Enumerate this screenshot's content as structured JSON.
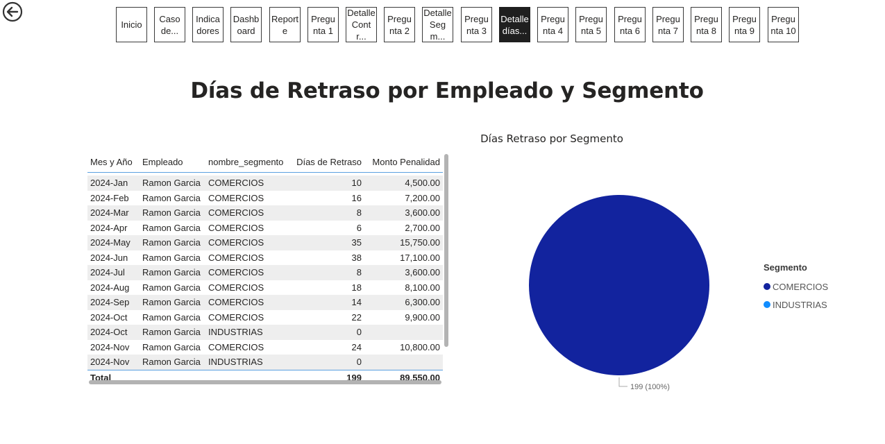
{
  "nav": {
    "back_icon": "back-arrow-icon",
    "buttons": [
      {
        "label": "Inicio",
        "active": false
      },
      {
        "label": "Caso de...",
        "active": false
      },
      {
        "label": "Indicadores",
        "active": false
      },
      {
        "label": "Dashboard",
        "active": false
      },
      {
        "label": "Reporte",
        "active": false
      },
      {
        "label": "Pregunta 1",
        "active": false
      },
      {
        "label": "Detalle Contr...",
        "active": false
      },
      {
        "label": "Pregunta 2",
        "active": false
      },
      {
        "label": "Detalle Segm...",
        "active": false
      },
      {
        "label": "Pregunta 3",
        "active": false
      },
      {
        "label": "Detalle días...",
        "active": true
      },
      {
        "label": "Pregunta 4",
        "active": false
      },
      {
        "label": "Pregunta 5",
        "active": false
      },
      {
        "label": "Pregunta 6",
        "active": false
      },
      {
        "label": "Pregunta 7",
        "active": false
      },
      {
        "label": "Pregunta 8",
        "active": false
      },
      {
        "label": "Pregunta 9",
        "active": false
      },
      {
        "label": "Pregunta 10",
        "active": false
      }
    ]
  },
  "page_title": "Días de Retraso por Empleado y Segmento",
  "table": {
    "columns": [
      "Mes y Año",
      "Empleado",
      "nombre_segmento",
      "Días de Retraso",
      "Monto Penalidad"
    ],
    "rows": [
      [
        "2024-Jan",
        "Ramon Garcia",
        "COMERCIOS",
        "10",
        "4,500.00"
      ],
      [
        "2024-Feb",
        "Ramon Garcia",
        "COMERCIOS",
        "16",
        "7,200.00"
      ],
      [
        "2024-Mar",
        "Ramon Garcia",
        "COMERCIOS",
        "8",
        "3,600.00"
      ],
      [
        "2024-Apr",
        "Ramon Garcia",
        "COMERCIOS",
        "6",
        "2,700.00"
      ],
      [
        "2024-May",
        "Ramon Garcia",
        "COMERCIOS",
        "35",
        "15,750.00"
      ],
      [
        "2024-Jun",
        "Ramon Garcia",
        "COMERCIOS",
        "38",
        "17,100.00"
      ],
      [
        "2024-Jul",
        "Ramon Garcia",
        "COMERCIOS",
        "8",
        "3,600.00"
      ],
      [
        "2024-Aug",
        "Ramon Garcia",
        "COMERCIOS",
        "18",
        "8,100.00"
      ],
      [
        "2024-Sep",
        "Ramon Garcia",
        "COMERCIOS",
        "14",
        "6,300.00"
      ],
      [
        "2024-Oct",
        "Ramon Garcia",
        "COMERCIOS",
        "22",
        "9,900.00"
      ],
      [
        "2024-Oct",
        "Ramon Garcia",
        "INDUSTRIAS",
        "0",
        ""
      ],
      [
        "2024-Nov",
        "Ramon Garcia",
        "COMERCIOS",
        "24",
        "10,800.00"
      ],
      [
        "2024-Nov",
        "Ramon Garcia",
        "INDUSTRIAS",
        "0",
        ""
      ]
    ],
    "total": {
      "label": "Total",
      "dias": "199",
      "monto": "89,550.00"
    }
  },
  "chart_data": {
    "type": "pie",
    "title": "Días Retraso por Segmento",
    "legend_title": "Segmento",
    "legend_position": "right",
    "categories": [
      "COMERCIOS",
      "INDUSTRIAS"
    ],
    "values": [
      199,
      0
    ],
    "colors": [
      "#12239E",
      "#118DFF"
    ],
    "data_labels": [
      "199 (100%)",
      ""
    ]
  }
}
